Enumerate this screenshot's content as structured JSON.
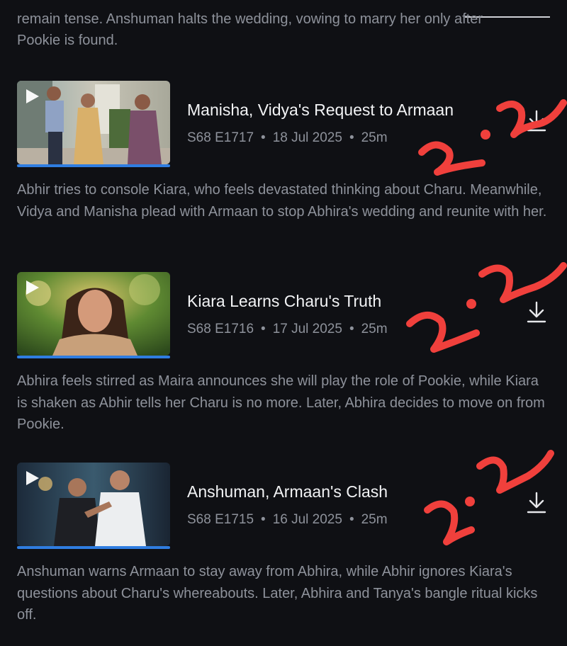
{
  "previous_description_tail": {
    "line1": "remain tense. Anshuman halts the wedding, vowing to marry her only after",
    "line2": "Pookie is found."
  },
  "episodes": [
    {
      "title": "Manisha, Vidya's Request to Armaan",
      "code": "S68 E1717",
      "date": "18 Jul 2025",
      "duration": "25m",
      "description": "Abhir tries to console Kiara, who feels devastated thinking about Charu. Meanwhile, Vidya and Manisha plead with Armaan to stop Abhira's wedding and reunite with her.",
      "watched_fraction": 1.0
    },
    {
      "title": "Kiara Learns Charu's Truth",
      "code": "S68 E1716",
      "date": "17 Jul 2025",
      "duration": "25m",
      "description": "Abhira feels stirred as Maira announces she will play the role of Pookie, while Kiara is shaken as Abhir tells her Charu is no more. Later, Abhira decides to move on from Pookie.",
      "watched_fraction": 1.0
    },
    {
      "title": "Anshuman, Armaan's Clash",
      "code": "S68 E1715",
      "date": "16 Jul 2025",
      "duration": "25m",
      "description": "Anshuman warns Armaan to stay away from Abhira, while Abhir ignores Kiara's questions about Charu's whereabouts. Later, Abhira and Tanya's bangle ritual kicks off.",
      "watched_fraction": 1.0
    }
  ],
  "meta_separator": "•",
  "icons": {
    "play": "play-icon",
    "download": "download-icon"
  },
  "colors": {
    "background": "#0f1014",
    "progress": "#2f7de1",
    "annotation": "#f0403c"
  },
  "annotation_text": "2:2"
}
